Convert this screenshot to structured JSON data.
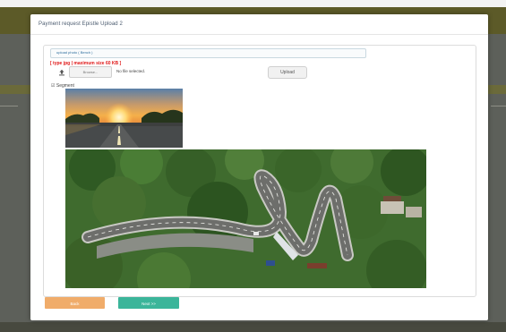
{
  "modal": {
    "title": "Payment request Epistle Upload 2"
  },
  "upload": {
    "tab_label": "upload photo ( Bench )",
    "hint": "[ type jpg | maximum size 60 KB ]",
    "browse_label": "Browse...",
    "no_file_text": "No file selected.",
    "upload_button": "Upload"
  },
  "category": {
    "label": "☑ Segment"
  },
  "footer": {
    "back_label": "Back",
    "next_label": "Next >>"
  },
  "colors": {
    "hint": "#e01818",
    "back_button": "#f0ac6a",
    "next_button": "#3bb59a"
  }
}
